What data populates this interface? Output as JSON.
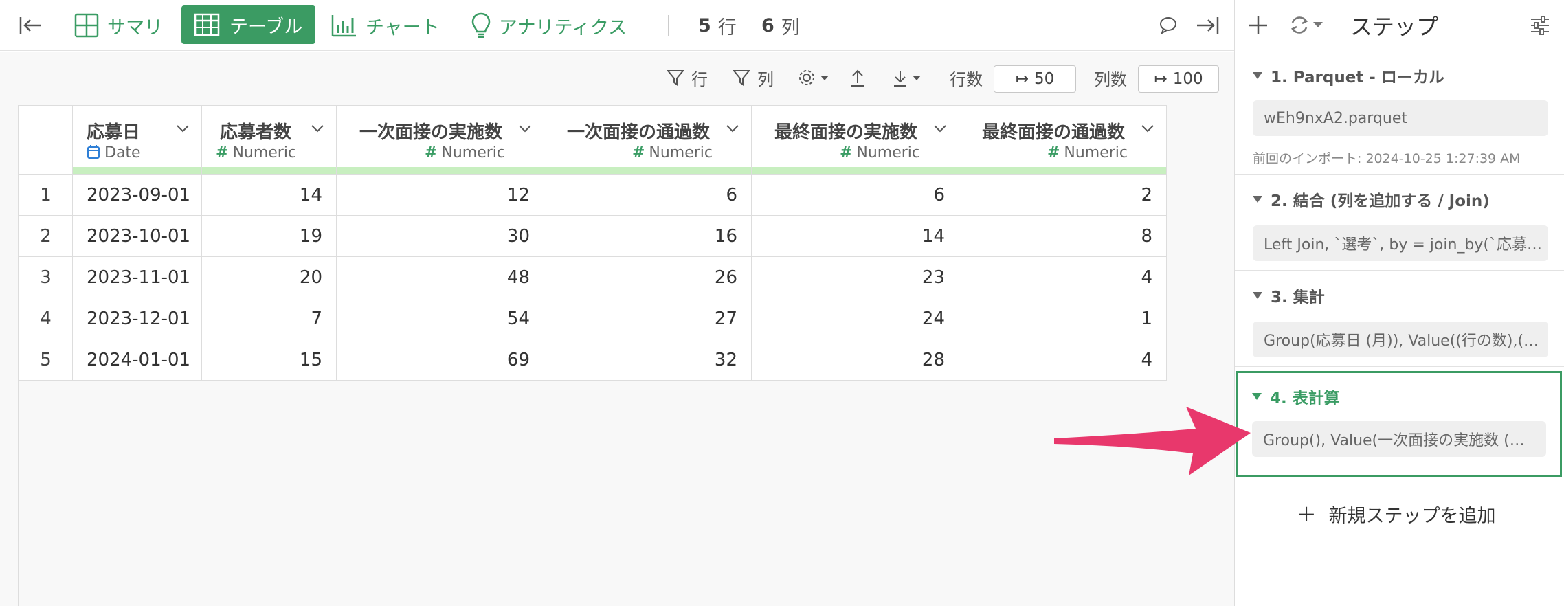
{
  "toolbar": {
    "summary_label": "サマリ",
    "table_label": "テーブル",
    "chart_label": "チャート",
    "analytics_label": "アナリティクス",
    "rows_count": "5",
    "rows_unit": "行",
    "cols_count": "6",
    "cols_unit": "列"
  },
  "subbar": {
    "filter_rows": "行",
    "filter_cols": "列",
    "row_count_label": "行数",
    "row_count_value": "50",
    "col_count_label": "列数",
    "col_count_value": "100"
  },
  "table": {
    "columns": [
      {
        "name": "応募日",
        "type": "Date"
      },
      {
        "name": "応募者数",
        "type": "Numeric"
      },
      {
        "name": "一次面接の実施数",
        "type": "Numeric"
      },
      {
        "name": "一次面接の通過数",
        "type": "Numeric"
      },
      {
        "name": "最終面接の実施数",
        "type": "Numeric"
      },
      {
        "name": "最終面接の通過数",
        "type": "Numeric"
      }
    ],
    "rows": [
      {
        "idx": "1",
        "cells": [
          "2023-09-01",
          "14",
          "12",
          "6",
          "6",
          "2"
        ]
      },
      {
        "idx": "2",
        "cells": [
          "2023-10-01",
          "19",
          "30",
          "16",
          "14",
          "8"
        ]
      },
      {
        "idx": "3",
        "cells": [
          "2023-11-01",
          "20",
          "48",
          "26",
          "23",
          "4"
        ]
      },
      {
        "idx": "4",
        "cells": [
          "2023-12-01",
          "7",
          "54",
          "27",
          "24",
          "1"
        ]
      },
      {
        "idx": "5",
        "cells": [
          "2024-01-01",
          "15",
          "69",
          "32",
          "28",
          "4"
        ]
      }
    ]
  },
  "panel": {
    "title": "ステップ",
    "steps": [
      {
        "title": "1. Parquet - ローカル",
        "detail": "wEh9nxA2.parquet",
        "note": "前回のインポート: 2024-10-25 1:27:39 AM"
      },
      {
        "title": "2. 結合 (列を追加する / Join)",
        "detail": "Left Join, `選考`, by = join_by(`応募…"
      },
      {
        "title": "3. 集計",
        "detail": "Group(応募日 (月)), Value((行の数),(…"
      },
      {
        "title": "4. 表計算",
        "detail": "Group(), Value(一次面接の実施数 (…"
      }
    ],
    "add_step_label": "新規ステップを追加"
  },
  "colors": {
    "accent": "#3b9b63",
    "highlight_bar": "#c8efc0",
    "arrow": "#e8386c"
  }
}
